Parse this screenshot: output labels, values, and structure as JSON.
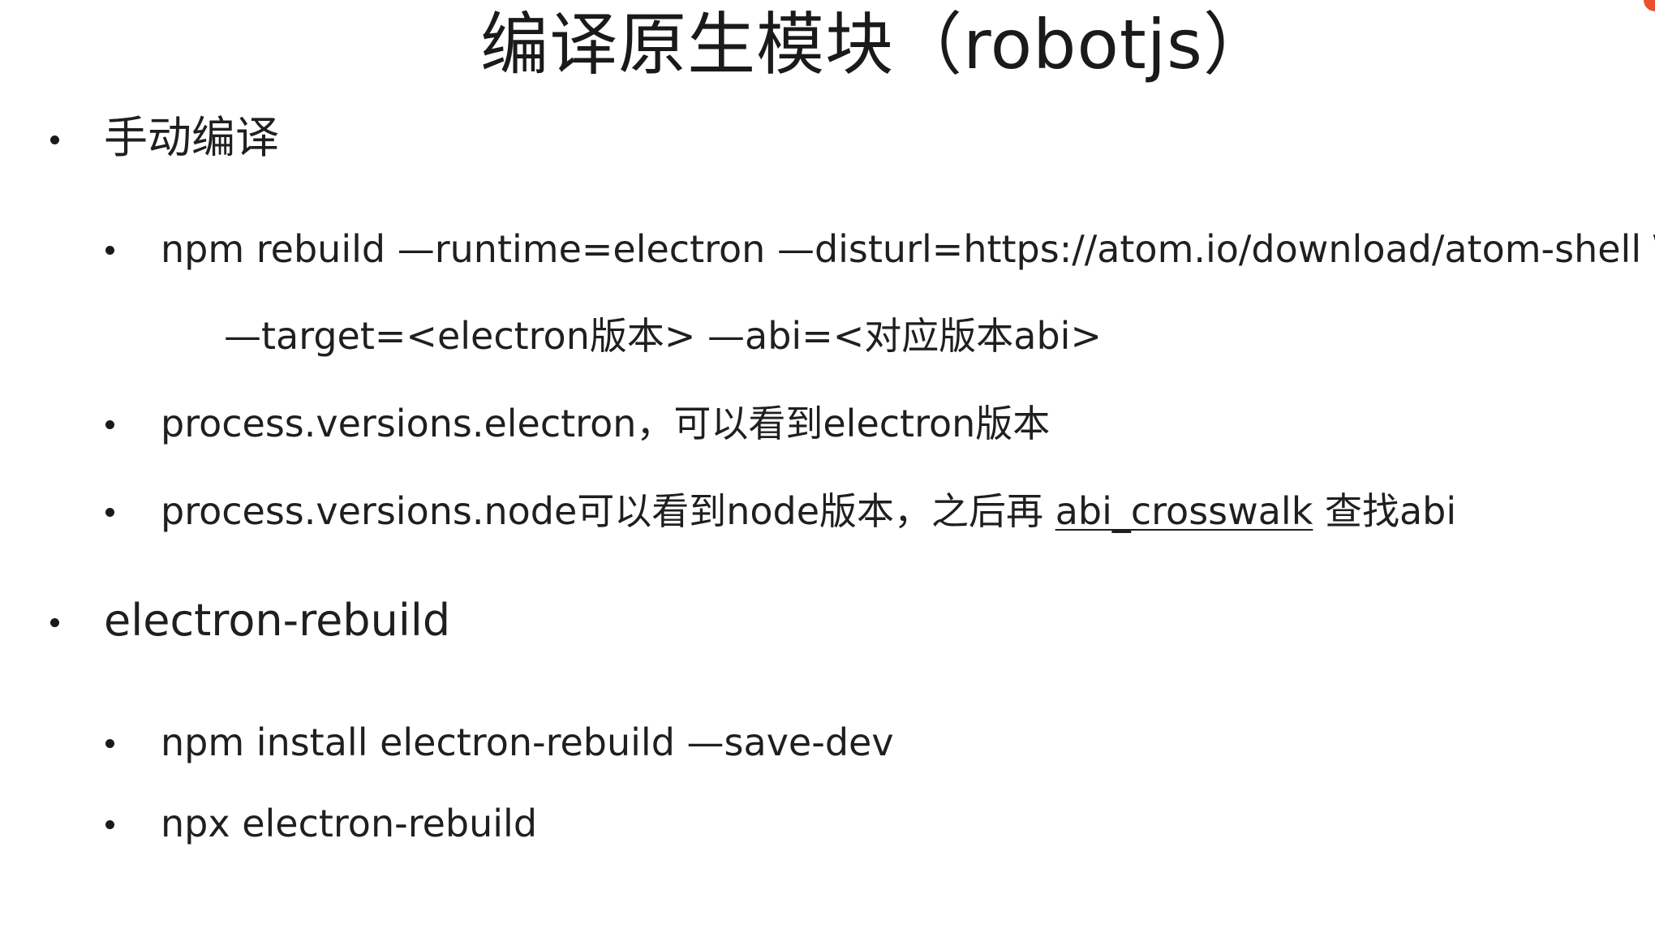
{
  "title": "编译原生模块（robotjs）",
  "sections": [
    {
      "label": "手动编译",
      "items": [
        {
          "line1": "npm rebuild —runtime=electron —disturl=https://atom.io/download/atom-shell \\",
          "line2": "—target=<electron版本>  —abi=<对应版本abi>"
        },
        {
          "text": "process.versions.electron，可以看到electron版本"
        },
        {
          "text_before": "process.versions.node可以看到node版本，之后再 ",
          "link": "abi_crosswalk",
          "text_after": " 查找abi"
        }
      ]
    },
    {
      "label": "electron-rebuild",
      "items": [
        {
          "text": "npm install electron-rebuild —save-dev"
        },
        {
          "text": "npx electron-rebuild"
        }
      ]
    }
  ],
  "colors": {
    "text": "#1f1f1f",
    "background": "#ffffff",
    "corner_accent": "#e8502f"
  }
}
